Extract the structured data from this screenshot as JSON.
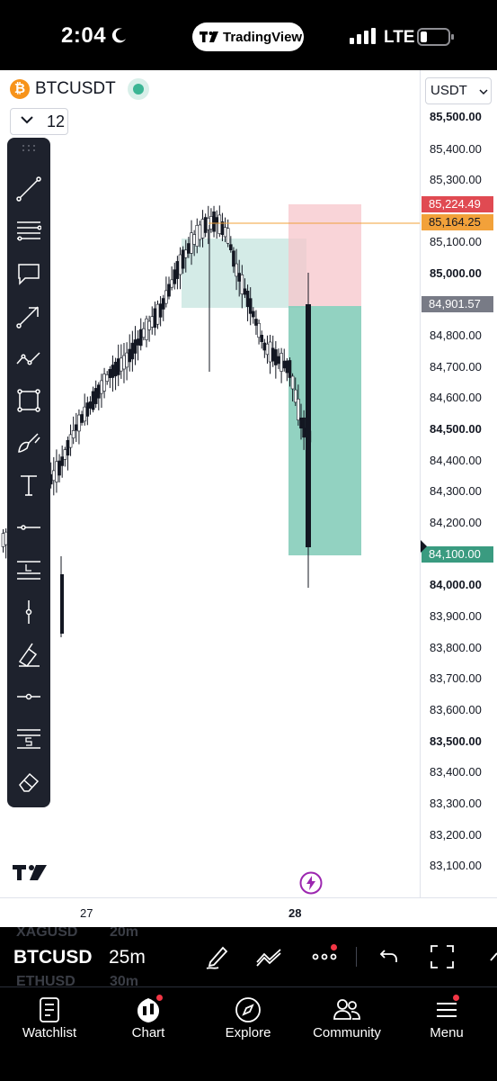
{
  "status_bar": {
    "time": "2:04",
    "app_pill": "TradingView",
    "network": "LTE"
  },
  "chart": {
    "symbol": "BTCUSDT",
    "interval": "12",
    "currency": "USDT",
    "price_axis": [
      "85,500.00",
      "85,400.00",
      "85,300.00",
      "85,100.00",
      "85,000.00",
      "84,800.00",
      "84,700.00",
      "84,600.00",
      "84,500.00",
      "84,400.00",
      "84,300.00",
      "84,200.00",
      "84,000.00",
      "83,900.00",
      "83,800.00",
      "83,700.00",
      "83,600.00",
      "83,500.00",
      "83,400.00",
      "83,300.00",
      "83,200.00",
      "83,100.00"
    ],
    "price_labels": {
      "stop": "85,224.49",
      "alert": "85,164.25",
      "entry": "84,901.57",
      "last": "84,100.00"
    },
    "time_axis": [
      "27",
      "28"
    ],
    "colors": {
      "up": "#ffffff",
      "down": "#131722",
      "stop_zone": "#f7c6cb",
      "target_zone": "#7fcab6",
      "alert_line": "#f0a03a",
      "last_price": "#3a9b80"
    }
  },
  "drawing_tools": [
    "trend-line-icon",
    "fib-lines-icon",
    "callout-icon",
    "arrow-icon",
    "path-icon",
    "rectangle-icon",
    "brush-icon",
    "text-icon",
    "horizontal-line-icon",
    "long-position-icon",
    "vertical-line-icon",
    "highlighter-icon",
    "horizontal-ray-icon",
    "short-position-icon",
    "eraser-icon"
  ],
  "bottom_toolbar": {
    "symbol": "BTCUSD",
    "interval": "25m",
    "ghost_rows": [
      "XAGUSD",
      "20m",
      "ETHUSD",
      "30m"
    ]
  },
  "tabs": [
    {
      "label": "Watchlist",
      "icon": "watchlist-icon"
    },
    {
      "label": "Chart",
      "icon": "chart-icon"
    },
    {
      "label": "Explore",
      "icon": "compass-icon"
    },
    {
      "label": "Community",
      "icon": "community-icon"
    },
    {
      "label": "Menu",
      "icon": "menu-icon"
    }
  ]
}
